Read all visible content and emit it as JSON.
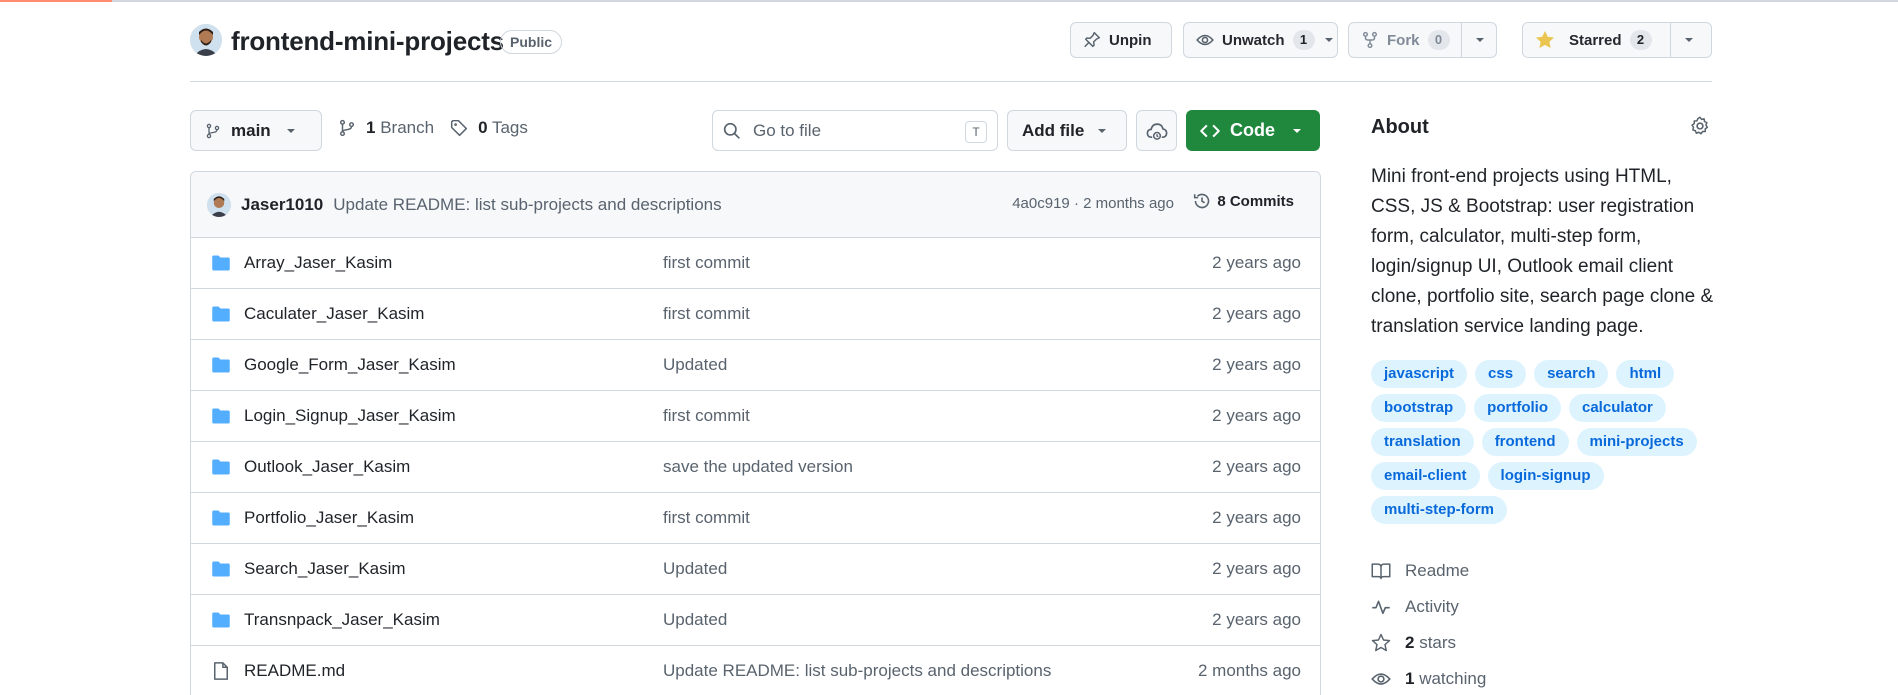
{
  "repo": {
    "name": "frontend-mini-projects",
    "visibility": "Public"
  },
  "header_actions": {
    "unpin_label": "Unpin",
    "unwatch_label": "Unwatch",
    "watch_count": "1",
    "fork_label": "Fork",
    "fork_count": "0",
    "starred_label": "Starred",
    "star_count": "2"
  },
  "toolbar": {
    "branch": "main",
    "branch_count": "1",
    "branch_word": "Branch",
    "tag_count": "0",
    "tag_word": "Tags",
    "goto_placeholder": "Go to file",
    "goto_key": "T",
    "add_file_label": "Add file",
    "code_label": "Code"
  },
  "latest_commit": {
    "author": "Jaser1010",
    "message": "Update README: list sub-projects and descriptions",
    "meta": "4a0c919 · 2 months ago",
    "commits_label": "8 Commits"
  },
  "files": [
    {
      "name": "Array_Jaser_Kasim",
      "message": "first commit",
      "date": "2 years ago",
      "type": "folder"
    },
    {
      "name": "Caculater_Jaser_Kasim",
      "message": "first commit",
      "date": "2 years ago",
      "type": "folder"
    },
    {
      "name": "Google_Form_Jaser_Kasim",
      "message": "Updated",
      "date": "2 years ago",
      "type": "folder"
    },
    {
      "name": "Login_Signup_Jaser_Kasim",
      "message": "first commit",
      "date": "2 years ago",
      "type": "folder"
    },
    {
      "name": "Outlook_Jaser_Kasim",
      "message": "save the updated version",
      "date": "2 years ago",
      "type": "folder"
    },
    {
      "name": "Portfolio_Jaser_Kasim",
      "message": "first commit",
      "date": "2 years ago",
      "type": "folder"
    },
    {
      "name": "Search_Jaser_Kasim",
      "message": "Updated",
      "date": "2 years ago",
      "type": "folder"
    },
    {
      "name": "Transnpack_Jaser_Kasim",
      "message": "Updated",
      "date": "2 years ago",
      "type": "folder"
    },
    {
      "name": "README.md",
      "message": "Update README: list sub-projects and descriptions",
      "date": "2 months ago",
      "type": "file"
    }
  ],
  "about": {
    "heading": "About",
    "description": "Mini front-end projects using HTML, CSS, JS & Bootstrap: user registration form, calculator, multi-step form, login/signup UI, Outlook email client clone, portfolio site, search page clone & translation service landing page.",
    "topics": [
      "javascript",
      "css",
      "search",
      "html",
      "bootstrap",
      "portfolio",
      "calculator",
      "translation",
      "frontend",
      "mini-projects",
      "email-client",
      "login-signup",
      "multi-step-form"
    ],
    "readme_label": "Readme",
    "activity_label": "Activity",
    "stars_count": "2",
    "stars_word": "stars",
    "watching_count": "1",
    "watching_word": "watching"
  },
  "colors": {
    "accent_green": "#1f883d",
    "link_blue": "#0969da",
    "folder_blue": "#54aeff",
    "star_yellow": "#eac54f"
  },
  "icons": [
    "repo-owner-avatar",
    "pin-icon",
    "eye-icon",
    "fork-icon",
    "star-icon",
    "branch-icon",
    "tag-icon",
    "search-icon",
    "cloud-icon",
    "code-icon",
    "history-icon",
    "folder-icon",
    "file-icon",
    "gear-icon",
    "book-icon",
    "pulse-icon",
    "chevron-down-icon"
  ]
}
